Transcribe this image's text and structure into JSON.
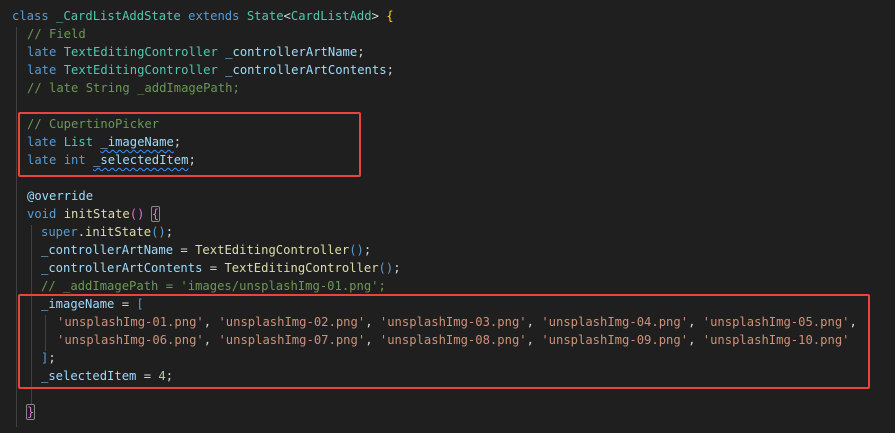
{
  "code": {
    "l1": {
      "kw_class": "class",
      "class_name": "_CardListAddState",
      "kw_extends": "extends",
      "base": "State",
      "lt": "<",
      "generic": "CardListAdd",
      "gt": ">",
      "space": " ",
      "brace": "{"
    },
    "l2": {
      "comment": "// Field"
    },
    "l3": {
      "kw": "late",
      "type": "TextEditingController",
      "name": "_controllerArtName",
      "semi": ";"
    },
    "l4": {
      "kw": "late",
      "type": "TextEditingController",
      "name": "_controllerArtContents",
      "semi": ";"
    },
    "l5": {
      "comment": "// late String _addImagePath;"
    },
    "l7": {
      "comment": "// CupertinoPicker"
    },
    "l8": {
      "kw": "late",
      "type": "List",
      "name": "_imageName",
      "semi": ";"
    },
    "l9": {
      "kw": "late",
      "type": "int",
      "name": "_selectedItem",
      "semi": ";"
    },
    "l11": {
      "annotation": "@override"
    },
    "l12": {
      "kw": "void",
      "name": "initState",
      "paren": "()",
      "brace": "{"
    },
    "l13": {
      "kw": "super",
      "dot": ".",
      "name": "initState",
      "paren": "()",
      "semi": ";"
    },
    "l14": {
      "name": "_controllerArtName",
      "eq": " = ",
      "call": "TextEditingController",
      "paren": "()",
      "semi": ";"
    },
    "l15": {
      "name": "_controllerArtContents",
      "eq": " = ",
      "call": "TextEditingController",
      "paren": "()",
      "semi": ";"
    },
    "l16": {
      "comment": "// _addImagePath = 'images/unsplashImg-01.png';"
    },
    "l17": {
      "name": "_imageName",
      "eq": " = ",
      "bracket": "["
    },
    "l18": {
      "items": [
        "'unsplashImg-01.png'",
        "'unsplashImg-02.png'",
        "'unsplashImg-03.png'",
        "'unsplashImg-04.png'",
        "'unsplashImg-05.png'"
      ],
      "sep": ", ",
      "trail": ","
    },
    "l19": {
      "items": [
        "'unsplashImg-06.png'",
        "'unsplashImg-07.png'",
        "'unsplashImg-08.png'",
        "'unsplashImg-09.png'",
        "'unsplashImg-10.png'"
      ],
      "sep": ", "
    },
    "l20": {
      "close": "]",
      "semi": ";"
    },
    "l21": {
      "name": "_selectedItem",
      "eq": " = ",
      "value": "4",
      "semi": ";"
    },
    "l23": {
      "brace": "}"
    }
  },
  "colors": {
    "background": "#1f1f1f",
    "highlight_box": "#e8453c",
    "keyword": "#569cd6",
    "type": "#4ec9b0",
    "function": "#dcdcaa",
    "variable": "#9cdcfe",
    "string": "#ce9178",
    "number": "#b5cea8",
    "comment": "#6a9955"
  }
}
